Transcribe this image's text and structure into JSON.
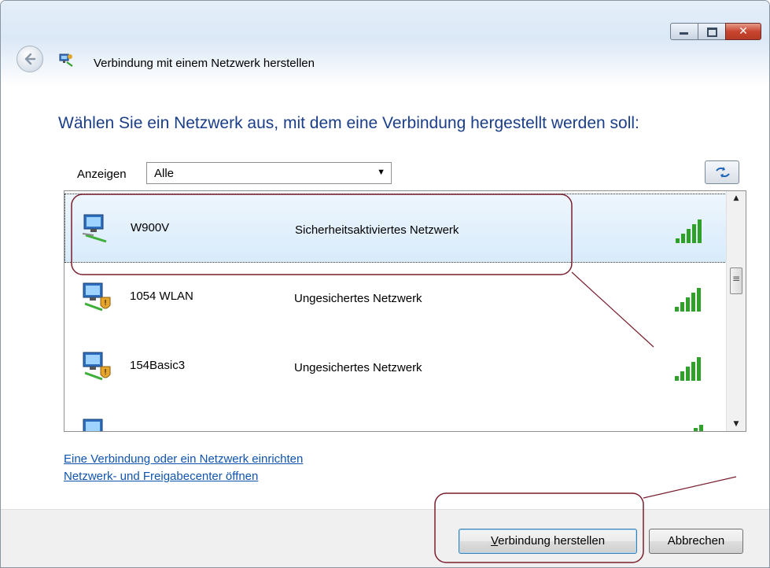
{
  "window": {
    "title": "Verbindung mit einem Netzwerk herstellen"
  },
  "main": {
    "heading": "Wählen Sie ein Netzwerk aus, mit dem eine Verbindung hergestellt werden soll:",
    "filter": {
      "label": "Anzeigen",
      "selected": "Alle"
    }
  },
  "networks": [
    {
      "name": "W900V",
      "security": "Sicherheitsaktiviertes Netzwerk",
      "signal_bars": 5,
      "secured": true,
      "selected": true
    },
    {
      "name": "1054 WLAN",
      "security": "Ungesichertes Netzwerk",
      "signal_bars": 5,
      "secured": false,
      "selected": false
    },
    {
      "name": "154Basic3",
      "security": "Ungesichertes Netzwerk",
      "signal_bars": 5,
      "secured": false,
      "selected": false
    }
  ],
  "links": {
    "setup": "Eine Verbindung oder ein Netzwerk einrichten",
    "center": "Netzwerk- und Freigabecenter öffnen"
  },
  "buttons": {
    "connect": "Verbindung herstellen",
    "connect_accelerator": "V",
    "cancel": "Abbrechen"
  },
  "colors": {
    "heading": "#1b3e8a",
    "link": "#0f54b0",
    "signal": "#2fa02a",
    "annotation": "#7a1f2f",
    "selection": "#d8ebfb"
  }
}
